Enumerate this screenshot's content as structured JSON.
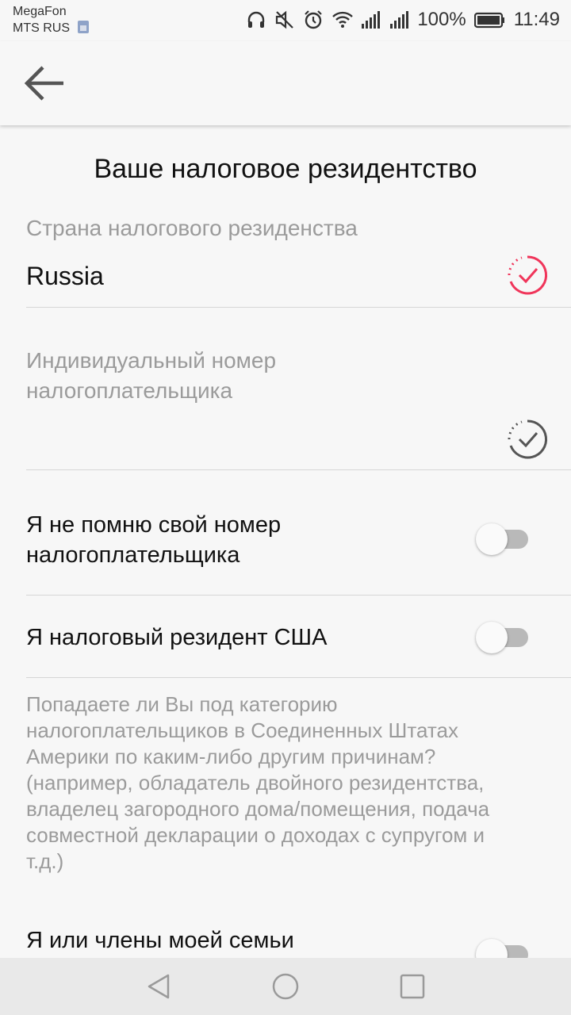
{
  "status_bar": {
    "carrier_1": "MegaFon",
    "carrier_2": "MTS RUS",
    "battery_text": "100%",
    "time": "11:49",
    "icons": [
      "headphones-icon",
      "mute-icon",
      "alarm-icon",
      "wifi-icon",
      "signal-icon",
      "signal-icon",
      "battery-icon"
    ]
  },
  "app_bar": {
    "back_icon": "arrow-left-icon"
  },
  "page": {
    "title": "Ваше налоговое резидентство"
  },
  "fields": {
    "country_label": "Страна налогового резиденства",
    "country_value": "Russia",
    "country_status_color": "#f0355a",
    "inn_label_line1": "Индивидуальный номер",
    "inn_label_line2": "налогоплательщика",
    "inn_value": "",
    "inn_status_color": "#555555"
  },
  "toggles": {
    "forgot_inn_line1": "Я не помню свой номер",
    "forgot_inn_line2": "налогоплательщика",
    "forgot_inn_on": false,
    "us_resident_label": "Я налоговый резидент США",
    "us_resident_on": false,
    "family_label": "Я или члены моей семьи",
    "family_on": false
  },
  "description": {
    "line1": "Попадаете ли Вы под категорию",
    "line2": "налогоплательщиков в Соединенных Штатах",
    "line3": "Америки по каким-либо другим причинам?",
    "line4": "(например, обладатель двойного резидентства,",
    "line5": "владелец загородного дома/помещения, подача",
    "line6": "совместной декларации о доходах с супругом и",
    "line7": "т.д.)"
  },
  "nav_bar": {
    "icons": [
      "back-triangle-icon",
      "home-circle-icon",
      "recents-square-icon"
    ]
  }
}
